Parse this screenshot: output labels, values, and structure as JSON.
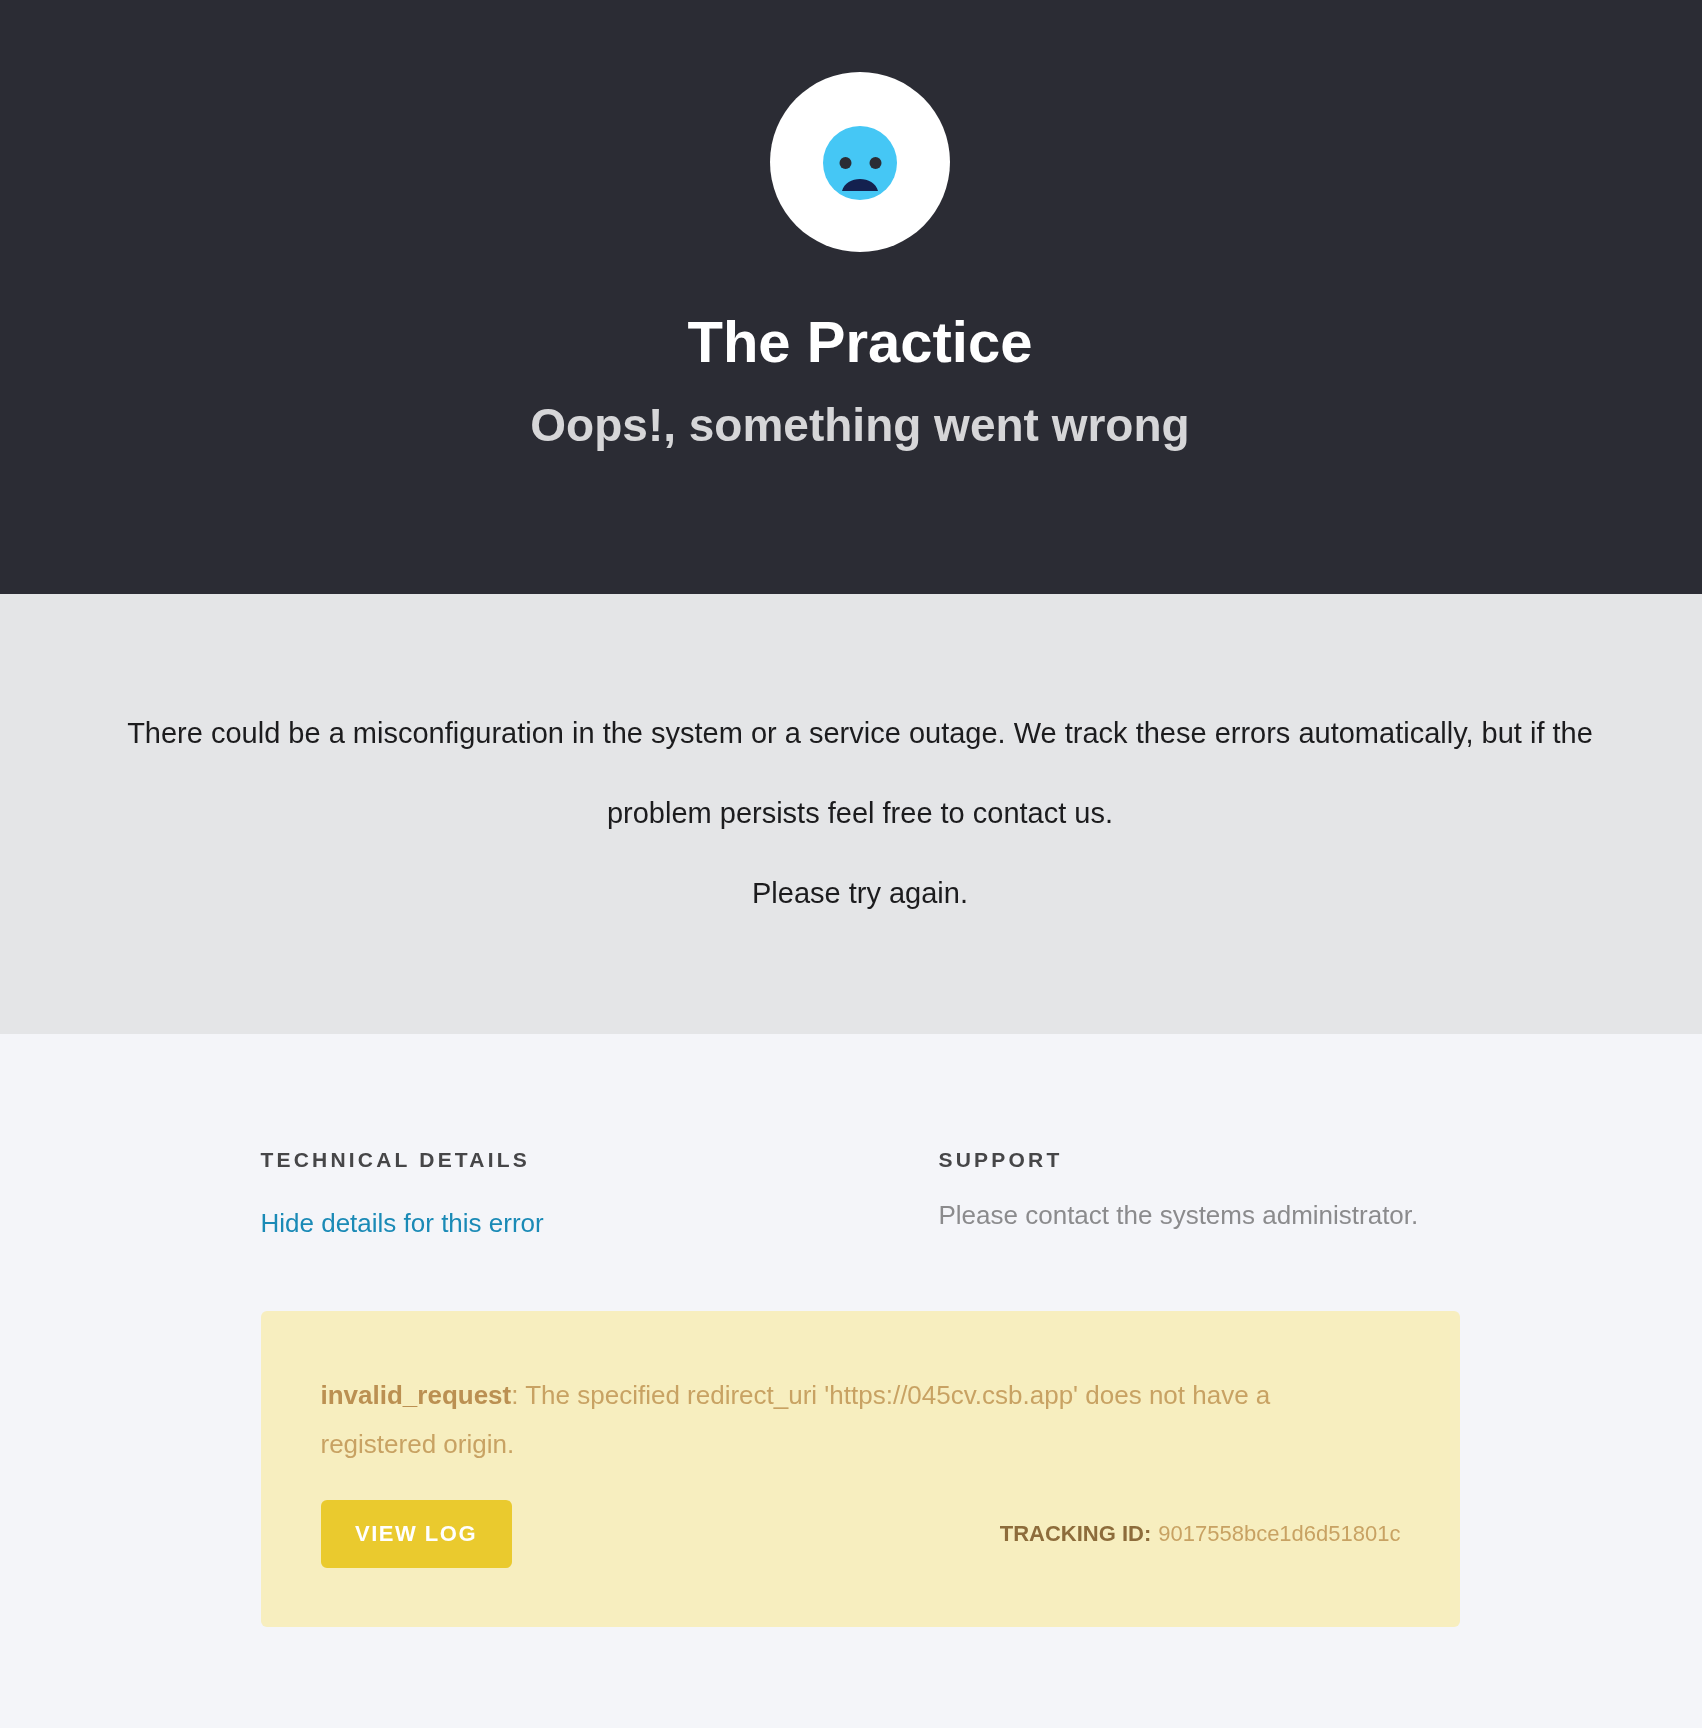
{
  "header": {
    "title": "The Practice",
    "subtitle": "Oops!, something went wrong"
  },
  "message": {
    "paragraphs": [
      "There could be a misconfiguration in the system or a service outage. We track these errors automatically, but if the problem persists feel free to contact us.",
      "Please try again."
    ]
  },
  "details": {
    "heading": "TECHNICAL DETAILS",
    "toggle_link": "Hide details for this error",
    "expanded": true
  },
  "support": {
    "heading": "SUPPORT",
    "text": "Please contact the systems administrator."
  },
  "error": {
    "message": "**invalid_request**: The specified redirect_uri 'https://045cv.csb.app' does not have a registered origin.",
    "button": "VIEW LOG",
    "tracking_label": "TRACKING ID:",
    "tracking_id": "9017558bce1d6d51801c"
  }
}
